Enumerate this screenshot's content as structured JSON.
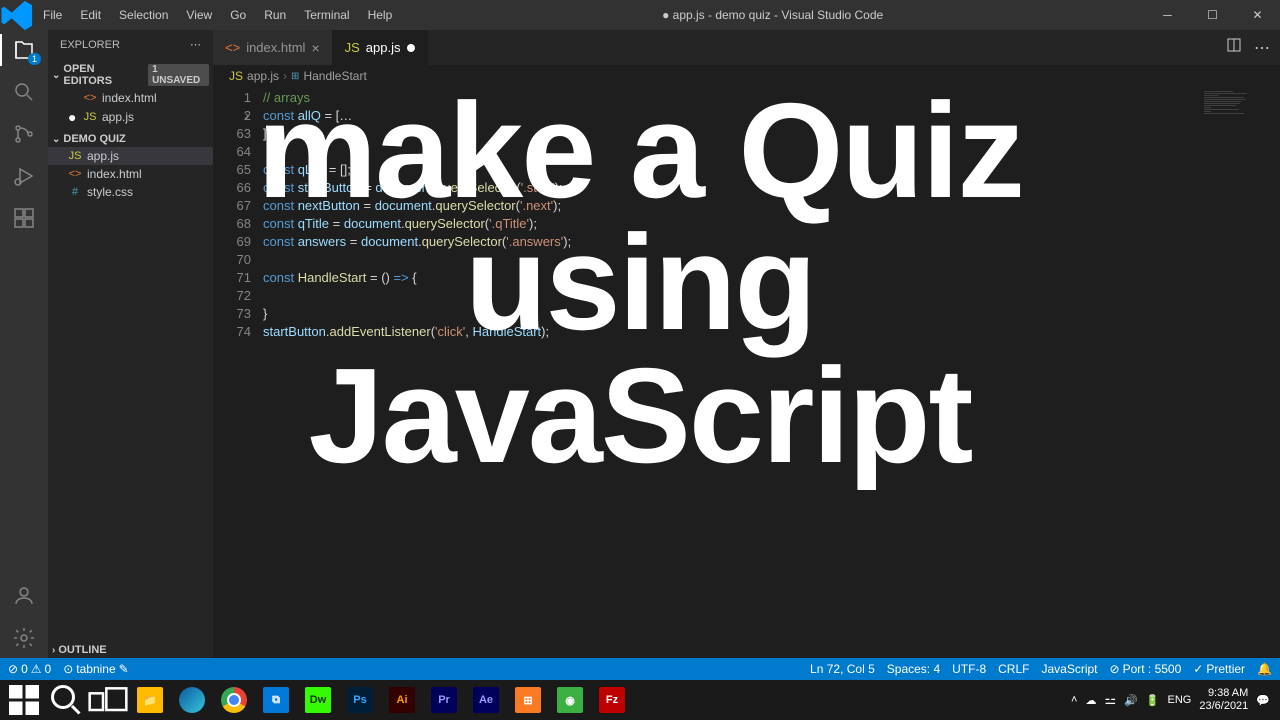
{
  "titlebar": {
    "menus": [
      "File",
      "Edit",
      "Selection",
      "View",
      "Go",
      "Run",
      "Terminal",
      "Help"
    ],
    "title": "● app.js - demo quiz - Visual Studio Code"
  },
  "activitybar": {
    "badge": "1"
  },
  "sidebar": {
    "title": "EXPLORER",
    "openEditors": {
      "label": "OPEN EDITORS",
      "unsaved": "1 UNSAVED",
      "items": [
        {
          "modified": false,
          "icon": "html",
          "name": "index.html"
        },
        {
          "modified": true,
          "icon": "js",
          "name": "app.js"
        }
      ]
    },
    "project": {
      "label": "DEMO QUIZ",
      "items": [
        {
          "icon": "js",
          "name": "app.js",
          "active": true
        },
        {
          "icon": "html",
          "name": "index.html",
          "active": false
        },
        {
          "icon": "css",
          "name": "style.css",
          "active": false
        }
      ]
    },
    "outline": "OUTLINE"
  },
  "tabs": [
    {
      "icon": "html",
      "name": "index.html",
      "active": false,
      "modified": false
    },
    {
      "icon": "js",
      "name": "app.js",
      "active": true,
      "modified": true
    }
  ],
  "breadcrumb": {
    "file": "app.js",
    "symbol": "HandleStart"
  },
  "code": {
    "lines": [
      {
        "n": "1",
        "html": "<span class='cm'>// arrays</span>"
      },
      {
        "n": "2",
        "fold": true,
        "html": "<span class='kw'>const</span> <span class='var'>allQ</span> <span class='op'>=</span> <span class='op'>[</span><span class='op'>…</span>"
      },
      {
        "n": "63",
        "html": "<span class='op'>];</span>"
      },
      {
        "n": "64",
        "html": ""
      },
      {
        "n": "65",
        "html": "<span class='kw'>const</span> <span class='var'>qList</span> <span class='op'>=</span> <span class='op'>[];</span>"
      },
      {
        "n": "66",
        "html": "<span class='kw'>const</span> <span class='var'>startButton</span> <span class='op'>=</span> <span class='var'>document</span>.<span class='fn'>querySelector</span>(<span class='str'>'.start'</span>);"
      },
      {
        "n": "67",
        "html": "<span class='kw'>const</span> <span class='var'>nextButton</span> <span class='op'>=</span> <span class='var'>document</span>.<span class='fn'>querySelector</span>(<span class='str'>'.next'</span>);"
      },
      {
        "n": "68",
        "html": "<span class='kw'>const</span> <span class='var'>qTitle</span> <span class='op'>=</span> <span class='var'>document</span>.<span class='fn'>querySelector</span>(<span class='str'>'.qTitle'</span>);"
      },
      {
        "n": "69",
        "html": "<span class='kw'>const</span> <span class='var'>answers</span> <span class='op'>=</span> <span class='var'>document</span>.<span class='fn'>querySelector</span>(<span class='str'>'.answers'</span>);"
      },
      {
        "n": "70",
        "html": ""
      },
      {
        "n": "71",
        "html": "<span class='kw'>const</span> <span class='fn'>HandleStart</span> <span class='op'>=</span> () <span class='kw'>=&gt;</span> <span class='op'>{</span>"
      },
      {
        "n": "72",
        "html": "    ",
        "highlight": true
      },
      {
        "n": "73",
        "html": "<span class='op'>}</span>"
      },
      {
        "n": "74",
        "html": "<span class='var'>startButton</span>.<span class='fn'>addEventListener</span>(<span class='str'>'click'</span>, <span class='var'>HandleStart</span>);"
      }
    ]
  },
  "statusbar": {
    "errors": "0",
    "warnings": "0",
    "tabnine": "tabnine",
    "position": "Ln 72, Col 5",
    "spaces": "Spaces: 4",
    "encoding": "UTF-8",
    "eol": "CRLF",
    "lang": "JavaScript",
    "port": "Port : 5500",
    "prettier": "Prettier"
  },
  "taskbar": {
    "lang": "ENG",
    "time": "9:38 AM",
    "date": "23/6/2021"
  },
  "overlay": {
    "line1": "make a Quiz",
    "line2": "using",
    "line3": "JavaScript"
  }
}
